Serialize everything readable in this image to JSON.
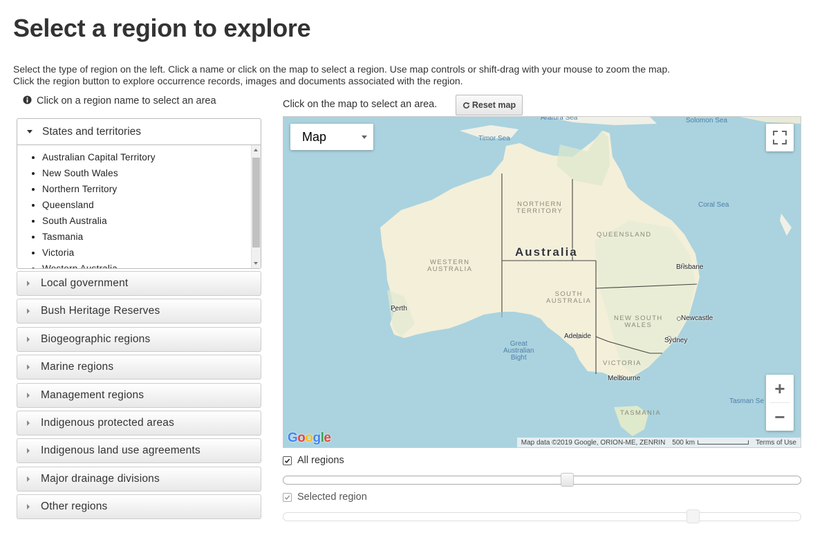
{
  "page": {
    "title": "Select a region to explore",
    "intro_line1": "Select the type of region on the left. Click a name or click on the map to select a region. Use map controls or shift-drag with your mouse to zoom the map.",
    "intro_line2": "Click the region button to explore occurrence records, images and documents associated with the region."
  },
  "left": {
    "hint": "Click on a region name to select an area",
    "open_group": {
      "label": "States and territories",
      "items": [
        "Australian Capital Territory",
        "New South Wales",
        "Northern Territory",
        "Queensland",
        "South Australia",
        "Tasmania",
        "Victoria",
        "Western Australia"
      ]
    },
    "groups": [
      "Local government",
      "Bush Heritage Reserves",
      "Biogeographic regions",
      "Marine regions",
      "Management regions",
      "Indigenous protected areas",
      "Indigenous land use agreements",
      "Major drainage divisions",
      "Other regions"
    ]
  },
  "map": {
    "hint": "Click on the map to select an area.",
    "reset_label": "Reset map",
    "type_selected": "Map",
    "country_label": "Australia",
    "water_labels": {
      "arafura": "Arafura Sea",
      "timor": "Timor Sea",
      "solomon": "Solomon Sea",
      "coral": "Coral Sea",
      "tasman": "Tasman Se",
      "bight": "Great\nAustralian\nBight"
    },
    "state_labels": {
      "nt": "NORTHERN\nTERRITORY",
      "qld": "QUEENSLAND",
      "wa": "WESTERN\nAUSTRALIA",
      "sa": "SOUTH\nAUSTRALIA",
      "nsw": "NEW SOUTH\nWALES",
      "vic": "VICTORIA",
      "tas": "TASMANIA"
    },
    "cities": {
      "brisbane": "Brisbane",
      "perth": "Perth",
      "newcastle": "Newcastle",
      "adelaide": "Adelaide",
      "sydney": "Sydney",
      "melbourne": "Melbourne"
    },
    "zoom_in": "+",
    "zoom_out": "−",
    "logo": "Google",
    "attribution": "Map data ©2019 Google, ORION-ME, ZENRIN",
    "scale": "500 km",
    "terms": "Terms of Use",
    "colors": {
      "water": "#aad3df",
      "land": "#f1f0e6",
      "desert": "#f4efd9",
      "green": "#d8e8c4"
    }
  },
  "layers": {
    "all_label": "All regions",
    "all_checked": true,
    "all_opacity": 0.55,
    "selected_label": "Selected region",
    "selected_checked": true,
    "selected_opacity": 0.8
  }
}
